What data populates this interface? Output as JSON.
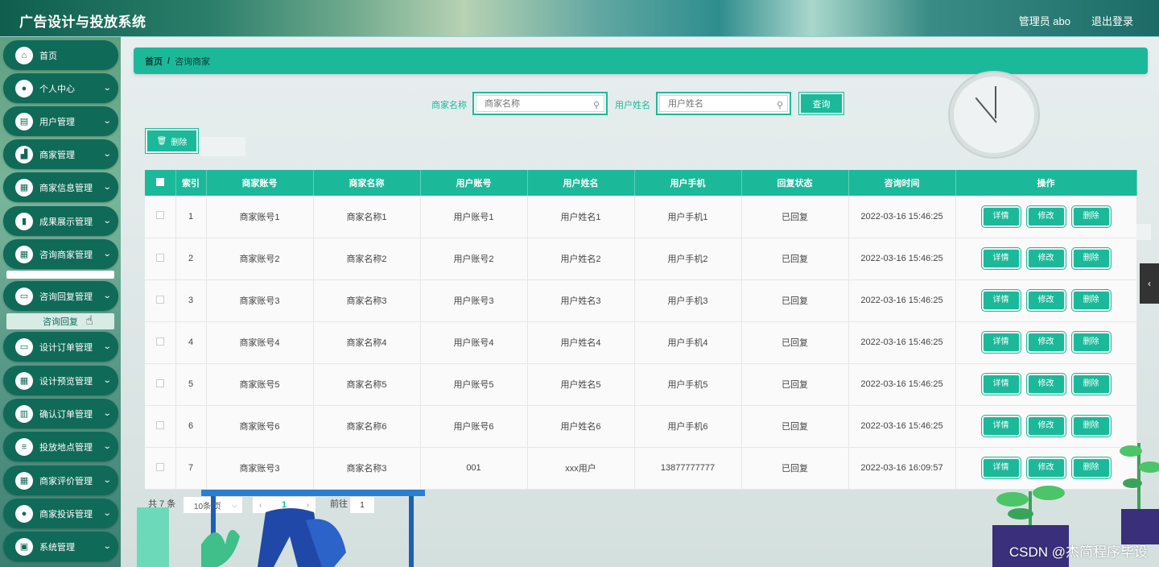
{
  "header": {
    "title": "广告设计与投放系统",
    "user": "管理员 abo",
    "logout": "退出登录"
  },
  "sidebar": {
    "items": [
      {
        "label": "首页",
        "icon": "home-icon",
        "glyph": "⌂",
        "has_children": false
      },
      {
        "label": "个人中心",
        "icon": "user-icon",
        "glyph": "●",
        "has_children": true
      },
      {
        "label": "用户管理",
        "icon": "clipboard-icon",
        "glyph": "▤",
        "has_children": true
      },
      {
        "label": "商家管理",
        "icon": "shop-icon",
        "glyph": "▟",
        "has_children": true
      },
      {
        "label": "商家信息管理",
        "icon": "grid-icon",
        "glyph": "▦",
        "has_children": true
      },
      {
        "label": "成果展示管理",
        "icon": "bar-chart-icon",
        "glyph": "▮",
        "has_children": true
      },
      {
        "label": "咨询商家管理",
        "icon": "grid-icon",
        "glyph": "▦",
        "has_children": true
      },
      {
        "label": "咨询回复管理",
        "icon": "monitor-icon",
        "glyph": "▭",
        "has_children": true
      },
      {
        "label": "设计订单管理",
        "icon": "monitor-icon",
        "glyph": "▭",
        "has_children": true
      },
      {
        "label": "设计预览管理",
        "icon": "grid-icon",
        "glyph": "▦",
        "has_children": true
      },
      {
        "label": "确认订单管理",
        "icon": "book-icon",
        "glyph": "▥",
        "has_children": true
      },
      {
        "label": "投放地点管理",
        "icon": "sliders-icon",
        "glyph": "≡",
        "has_children": true
      },
      {
        "label": "商家评价管理",
        "icon": "grid-icon",
        "glyph": "▦",
        "has_children": true
      },
      {
        "label": "商家投诉管理",
        "icon": "user-icon",
        "glyph": "●",
        "has_children": true
      },
      {
        "label": "系统管理",
        "icon": "lock-icon",
        "glyph": "▣",
        "has_children": true
      }
    ],
    "submenu_label": "咨询回复"
  },
  "breadcrumb": {
    "home": "首页",
    "separator": "/",
    "current": "咨询商家"
  },
  "search": {
    "merchant_name_label": "商家名称",
    "merchant_name_placeholder": "商家名称",
    "user_name_label": "用户姓名",
    "user_name_placeholder": "用户姓名",
    "query_button": "查询"
  },
  "toolbar": {
    "delete_label": "删除",
    "delete_icon": "trash-icon"
  },
  "table": {
    "columns": [
      "索引",
      "商家账号",
      "商家名称",
      "用户账号",
      "用户姓名",
      "用户手机",
      "回复状态",
      "咨询时间",
      "操作"
    ],
    "rows": [
      {
        "index": "1",
        "merchant_account": "商家账号1",
        "merchant_name": "商家名称1",
        "user_account": "用户账号1",
        "user_name": "用户姓名1",
        "phone": "用户手机1",
        "status": "已回复",
        "time": "2022-03-16 15:46:25"
      },
      {
        "index": "2",
        "merchant_account": "商家账号2",
        "merchant_name": "商家名称2",
        "user_account": "用户账号2",
        "user_name": "用户姓名2",
        "phone": "用户手机2",
        "status": "已回复",
        "time": "2022-03-16 15:46:25"
      },
      {
        "index": "3",
        "merchant_account": "商家账号3",
        "merchant_name": "商家名称3",
        "user_account": "用户账号3",
        "user_name": "用户姓名3",
        "phone": "用户手机3",
        "status": "已回复",
        "time": "2022-03-16 15:46:25"
      },
      {
        "index": "4",
        "merchant_account": "商家账号4",
        "merchant_name": "商家名称4",
        "user_account": "用户账号4",
        "user_name": "用户姓名4",
        "phone": "用户手机4",
        "status": "已回复",
        "time": "2022-03-16 15:46:25"
      },
      {
        "index": "5",
        "merchant_account": "商家账号5",
        "merchant_name": "商家名称5",
        "user_account": "用户账号5",
        "user_name": "用户姓名5",
        "phone": "用户手机5",
        "status": "已回复",
        "time": "2022-03-16 15:46:25"
      },
      {
        "index": "6",
        "merchant_account": "商家账号6",
        "merchant_name": "商家名称6",
        "user_account": "用户账号6",
        "user_name": "用户姓名6",
        "phone": "用户手机6",
        "status": "已回复",
        "time": "2022-03-16 15:46:25"
      },
      {
        "index": "7",
        "merchant_account": "商家账号3",
        "merchant_name": "商家名称3",
        "user_account": "001",
        "user_name": "xxx用户",
        "phone": "13877777777",
        "status": "已回复",
        "time": "2022-03-16 16:09:57"
      }
    ],
    "actions": {
      "detail": "详情",
      "edit": "修改",
      "delete": "删除"
    }
  },
  "pagination": {
    "total": "共 7 条",
    "page_size": "10条/页",
    "current_page": "1",
    "goto_label": "前往",
    "goto_value": "1"
  },
  "watermark": "CSDN @杰简程序毕设",
  "colors": {
    "accent": "#1bb99a",
    "sidebar_item": "#106a58"
  }
}
